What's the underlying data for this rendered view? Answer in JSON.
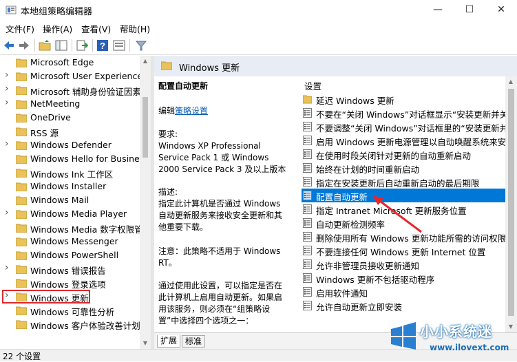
{
  "window": {
    "title": "本地组策略编辑器",
    "minimize_glyph": "—",
    "maximize_glyph": "☐",
    "close_glyph": "✕"
  },
  "menu": {
    "file": "文件(F)",
    "action": "操作(A)",
    "view": "查看(V)",
    "help": "帮助(H)"
  },
  "tree": {
    "items": [
      {
        "label": "Microsoft Edge",
        "expandable": false
      },
      {
        "label": "Microsoft User Experience",
        "expandable": true
      },
      {
        "label": "Microsoft 辅助身份验证因素",
        "expandable": true
      },
      {
        "label": "NetMeeting",
        "expandable": true
      },
      {
        "label": "OneDrive",
        "expandable": false
      },
      {
        "label": "RSS 源",
        "expandable": false
      },
      {
        "label": "Windows Defender",
        "expandable": true
      },
      {
        "label": "Windows Hello for Business",
        "expandable": false
      },
      {
        "label": "Windows Ink 工作区",
        "expandable": false
      },
      {
        "label": "Windows Installer",
        "expandable": false
      },
      {
        "label": "Windows Mail",
        "expandable": false
      },
      {
        "label": "Windows Media Player",
        "expandable": true
      },
      {
        "label": "Windows Media 数字权限管",
        "expandable": false
      },
      {
        "label": "Windows Messenger",
        "expandable": false
      },
      {
        "label": "Windows PowerShell",
        "expandable": false
      },
      {
        "label": "Windows 错误报告",
        "expandable": true
      },
      {
        "label": "Windows 登录选项",
        "expandable": false
      },
      {
        "label": "Windows 更新",
        "expandable": true,
        "selected": true
      },
      {
        "label": "Windows 可靠性分析",
        "expandable": false
      },
      {
        "label": "Windows 客户体验改善计划",
        "expandable": false
      }
    ]
  },
  "right_header": {
    "title": "Windows 更新"
  },
  "description": {
    "title": "配置自动更新",
    "edit_prefix": "编辑",
    "edit_link": "策略设置",
    "requirements": "要求:\nWindows XP Professional Service Pack 1 或 Windows 2000 Service Pack 3 及以上版本",
    "description": "描述:\n指定此计算机是否通过 Windows 自动更新服务来接收安全更新和其他重要下载。",
    "note": "注意：此策略不适用于 Windows RT。",
    "usage": "通过使用此设置，可以指定是否在此计算机上启用自动更新。如果启用该服务，则必须在“组策略设置”中选择四个选项之一："
  },
  "settings_list": {
    "header": "设置",
    "items": [
      {
        "label": "延迟 Windows 更新",
        "kind": "folder"
      },
      {
        "label": "不要在“关闭 Windows”对话框显示“安装更新并关机”",
        "kind": "policy"
      },
      {
        "label": "不要调整“关闭 Windows”对话框里的“安装更新并关机”",
        "kind": "policy"
      },
      {
        "label": "启用 Windows 更新电源管理以自动唤醒系统来安装计划",
        "kind": "policy"
      },
      {
        "label": "在使用时段关闭针对更新的自动重新启动",
        "kind": "policy"
      },
      {
        "label": "始终在计划的时间重新启动",
        "kind": "policy"
      },
      {
        "label": "指定在安装更新后自动重新启动的最后期限",
        "kind": "policy"
      },
      {
        "label": "配置自动更新",
        "kind": "policy",
        "selected": true
      },
      {
        "label": "指定 Intranet Microsoft 更新服务位置",
        "kind": "policy"
      },
      {
        "label": "自动更新检测频率",
        "kind": "policy"
      },
      {
        "label": "删除使用所有 Windows 更新功能所需的访问权限",
        "kind": "policy"
      },
      {
        "label": "不要连接任何 Windows 更新 Internet 位置",
        "kind": "policy"
      },
      {
        "label": "允许非管理员接收更新通知",
        "kind": "policy"
      },
      {
        "label": "Windows 更新不包括驱动程序",
        "kind": "policy"
      },
      {
        "label": "启用软件通知",
        "kind": "policy"
      },
      {
        "label": "允许自动更新立即安装",
        "kind": "policy"
      }
    ]
  },
  "tabs": [
    "扩展",
    "标准"
  ],
  "status": {
    "text": "22 个设置"
  },
  "watermark": {
    "line1": "小小系统迷",
    "line2": "www.ilovext.com"
  },
  "colors": {
    "selection": "#0078d7",
    "highlight_box": "#e0292d",
    "link": "#0b5fb4"
  }
}
